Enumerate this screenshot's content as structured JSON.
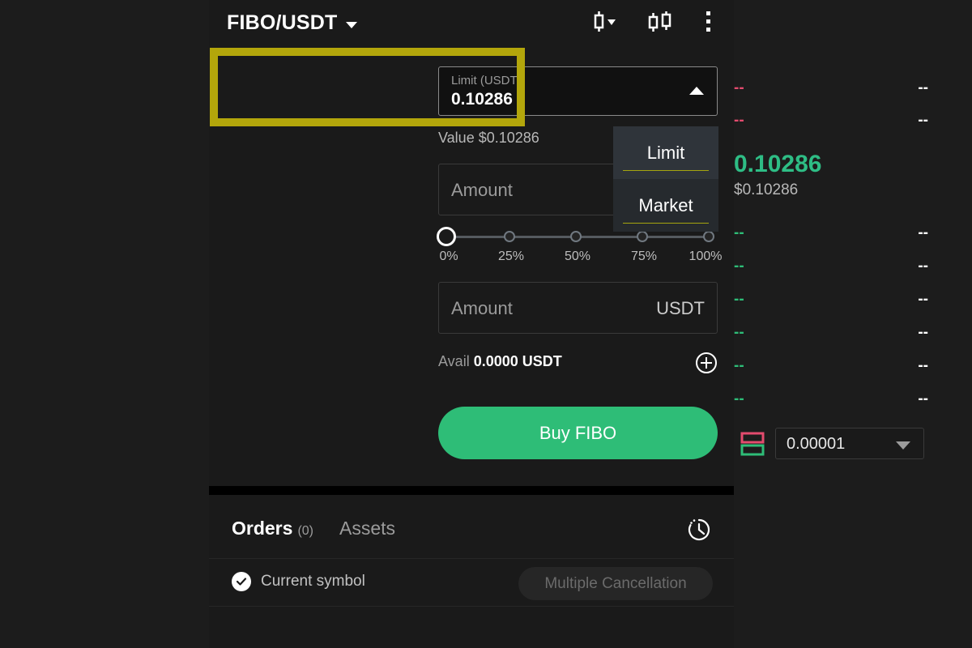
{
  "header": {
    "pair": "FIBO/USDT",
    "pair_caret_icon": "chevron-down-icon",
    "icons": {
      "candlestick_single": "candlestick-icon",
      "candlestick_double": "candlestick-compare-icon",
      "more": "more-vertical-icon"
    }
  },
  "order_form": {
    "price_label": "Limit (USDT)",
    "price_value": "0.10286",
    "price_caret_icon": "chevron-up-icon",
    "value_line": "Value $0.10286",
    "amount_base_placeholder": "Amount",
    "amount_quote_placeholder": "Amount",
    "amount_quote_unit": "USDT",
    "slider_ticks": [
      "0%",
      "25%",
      "50%",
      "75%",
      "100%"
    ],
    "slider_value": 0,
    "avail_label": "Avail",
    "avail_value": "0.0000 USDT",
    "add_funds_icon": "plus-circle-icon",
    "buy_button": "Buy FIBO",
    "highlight_color": "#b3a60b"
  },
  "order_type_dropdown": {
    "open": true,
    "options": [
      {
        "label": "Limit",
        "selected": true
      },
      {
        "label": "Market",
        "selected": false
      }
    ]
  },
  "orderbook": {
    "asks": [
      {
        "price": "--",
        "amount": "--"
      },
      {
        "price": "--",
        "amount": "--"
      }
    ],
    "last_price": "0.10286",
    "last_price_usd": "$0.10286",
    "last_price_color": "#2ebd85",
    "bids": [
      {
        "price": "--",
        "amount": "--"
      },
      {
        "price": "--",
        "amount": "--"
      },
      {
        "price": "--",
        "amount": "--"
      },
      {
        "price": "--",
        "amount": "--"
      },
      {
        "price": "--",
        "amount": "--"
      },
      {
        "price": "--",
        "amount": "--"
      }
    ],
    "ask_color": "#e34b6e",
    "bid_color": "#2ebd77",
    "depth_icon": "orderbook-depth-icon",
    "precision_value": "0.00001",
    "precision_caret_icon": "chevron-down-icon"
  },
  "orders_section": {
    "tabs": [
      {
        "label": "Orders",
        "count": "(0)",
        "active": true
      },
      {
        "label": "Assets",
        "count": "",
        "active": false
      }
    ],
    "history_icon": "history-clock-icon",
    "checkbox_label": "Current symbol",
    "checkbox_checked": true,
    "checkbox_icon": "check-circle-icon",
    "multiple_cancellation_button": "Multiple Cancellation"
  }
}
